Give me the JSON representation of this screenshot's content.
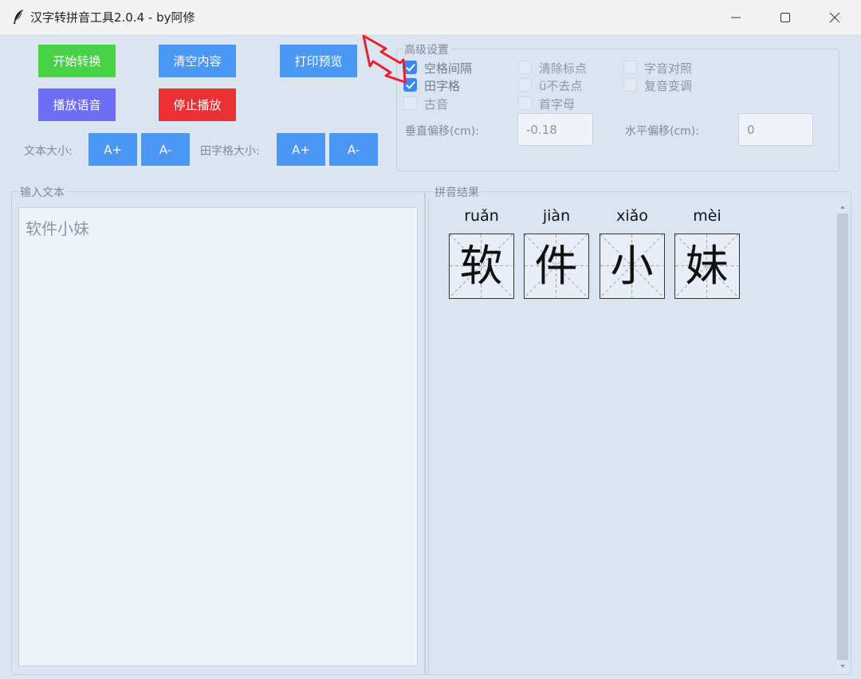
{
  "window": {
    "title": "汉字转拼音工具2.0.4 - by阿修"
  },
  "buttons": {
    "start": "开始转换",
    "clear": "清空内容",
    "print": "打印预览",
    "play": "播放语音",
    "stop": "停止播放",
    "text_plus": "A+",
    "text_minus": "A-",
    "grid_plus": "A+",
    "grid_minus": "A-"
  },
  "labels": {
    "text_size": "文本大小:",
    "grid_size": "田字格大小:"
  },
  "advanced": {
    "title": "高级设置",
    "options": [
      {
        "label": "空格间隔",
        "checked": true
      },
      {
        "label": "田字格",
        "checked": true
      },
      {
        "label": "古音",
        "checked": false
      },
      {
        "label": "清除标点",
        "checked": false
      },
      {
        "label": "ü不去点",
        "checked": false
      },
      {
        "label": "首字母",
        "checked": false
      },
      {
        "label": "字音对照",
        "checked": false
      },
      {
        "label": "复音变调",
        "checked": false
      }
    ],
    "vertical_offset_label": "垂直偏移(cm):",
    "vertical_offset_value": "-0.18",
    "horizontal_offset_label": "水平偏移(cm):",
    "horizontal_offset_value": "0"
  },
  "input": {
    "title": "输入文本",
    "text": "软件小妹"
  },
  "result": {
    "title": "拼音结果",
    "items": [
      {
        "pinyin": "ruǎn",
        "char": "软"
      },
      {
        "pinyin": "jiàn",
        "char": "件"
      },
      {
        "pinyin": "xiǎo",
        "char": "小"
      },
      {
        "pinyin": "mèi",
        "char": "妹"
      }
    ]
  },
  "colors": {
    "accent_blue": "#4a97f5",
    "start_green": "#49d148",
    "play_purple": "#6d6ef5",
    "stop_red": "#ec3136",
    "annotation_arrow": "#e8222a"
  },
  "icons": [
    "feather-icon",
    "minimize-icon",
    "maximize-icon",
    "close-icon",
    "annotation-arrow-icon",
    "checkmark-icon"
  ]
}
